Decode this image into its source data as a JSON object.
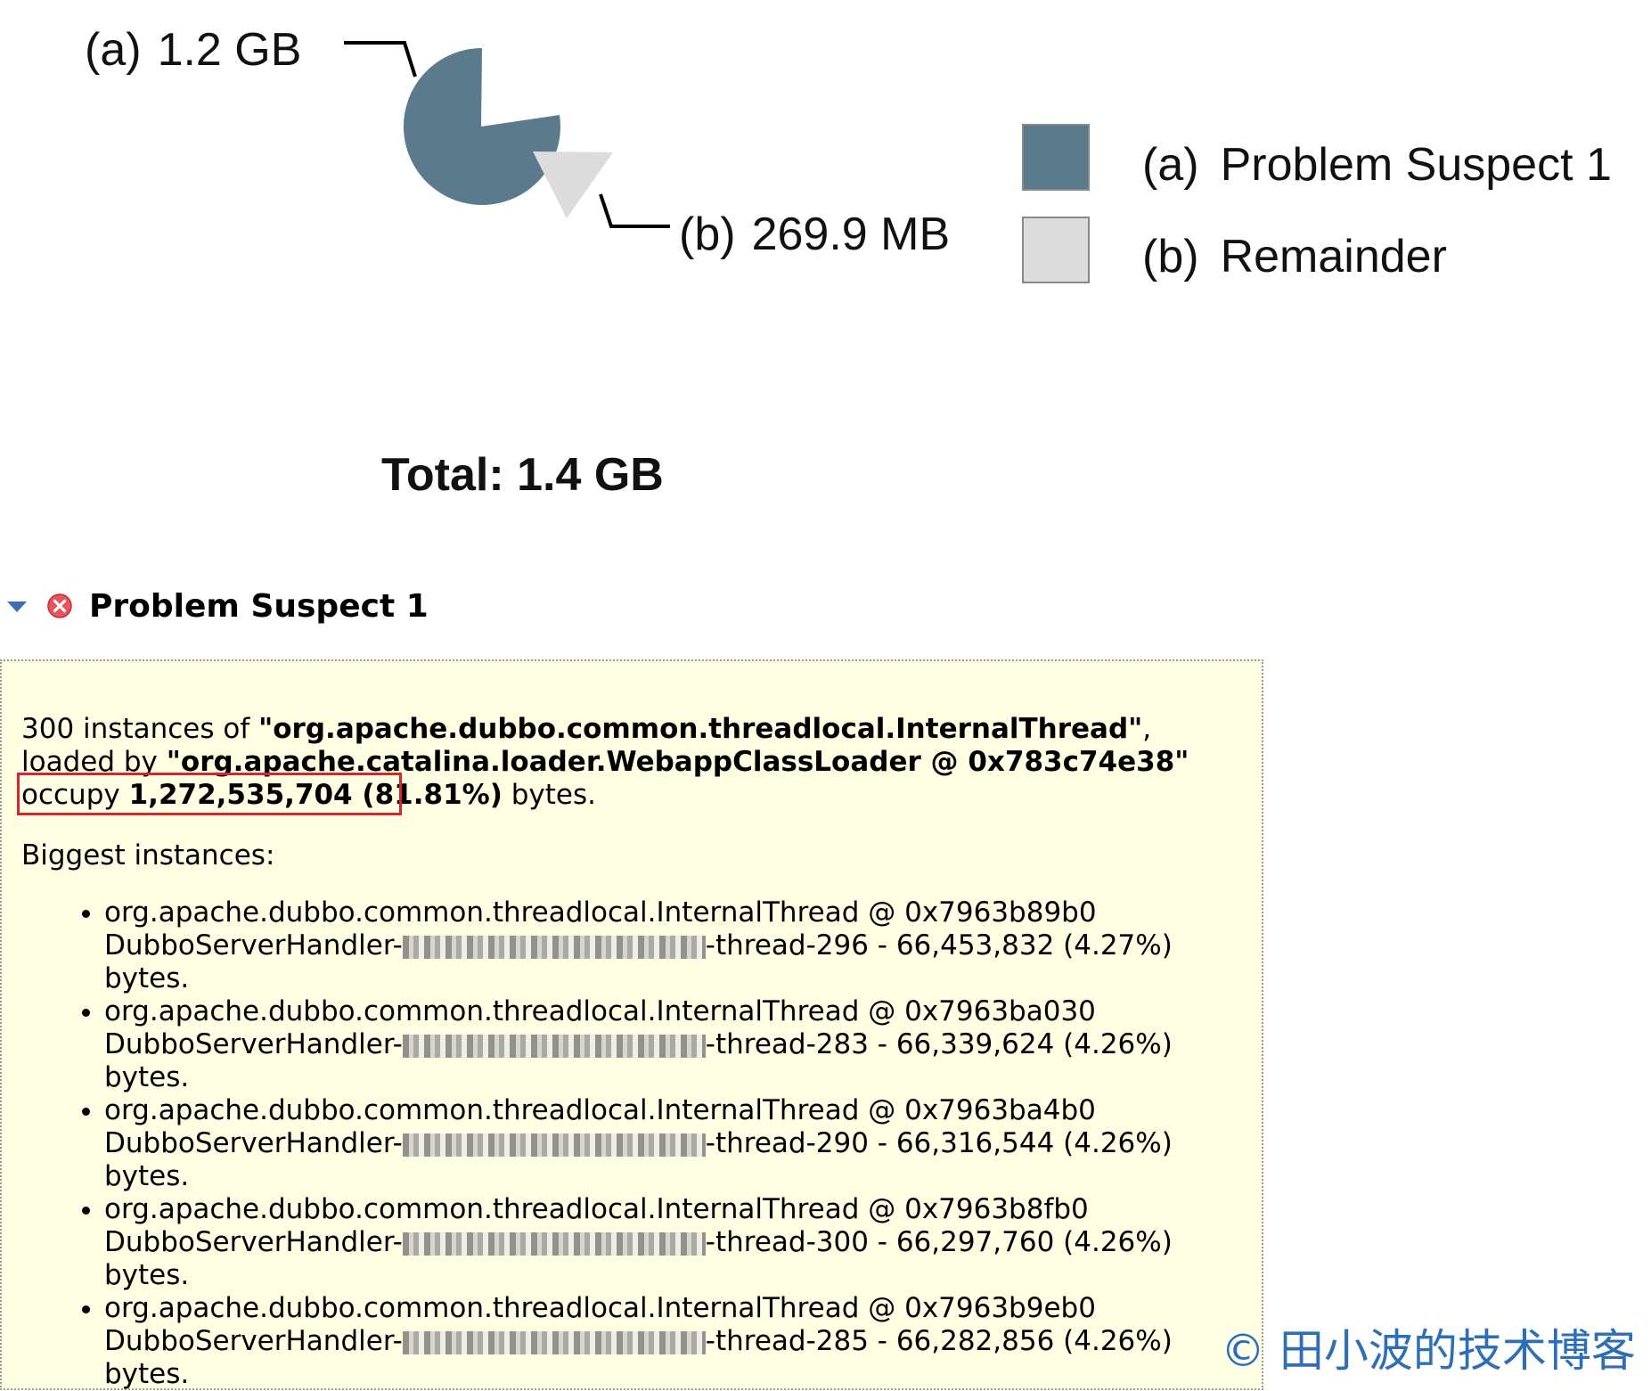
{
  "chart_data": {
    "type": "pie",
    "title": "",
    "slices": [
      {
        "label": "(a)",
        "value_text": "1.2 GB",
        "value_bytes": 1272535704,
        "legend": "Problem Suspect 1",
        "color": "#5b7a8c"
      },
      {
        "label": "(b)",
        "value_text": "269.9 MB",
        "value_bytes": 283007386,
        "legend": "Remainder",
        "color": "#dcdcdc"
      }
    ],
    "total_label": "Total: 1.4 GB",
    "legend_position": "right"
  },
  "section": {
    "title": "Problem Suspect 1",
    "expanded": true,
    "status_icon": "error-icon"
  },
  "suspect": {
    "count": "300",
    "instances_of": "instances of",
    "class_name": "\"org.apache.dubbo.common.threadlocal.InternalThread\"",
    "loaded_by_text": ", loaded by",
    "loader": "\"org.apache.catalina.loader.WebappClassLoader @ 0x783c74e38\"",
    "occupy_text": "occupy",
    "size": "1,272,535,704 (81.81%)",
    "bytes_text": "bytes.",
    "biggest_label": "Biggest instances:",
    "instances": [
      {
        "object": "org.apache.dubbo.common.threadlocal.InternalThread @ 0x7963b89b0",
        "handler": "DubboServerHandler-",
        "thread": "-thread-296 - 66,453,832 (4.27%)",
        "bytes": "bytes."
      },
      {
        "object": "org.apache.dubbo.common.threadlocal.InternalThread @ 0x7963ba030",
        "handler": "DubboServerHandler-",
        "thread": "-thread-283 - 66,339,624 (4.26%)",
        "bytes": "bytes."
      },
      {
        "object": "org.apache.dubbo.common.threadlocal.InternalThread @ 0x7963ba4b0",
        "handler": "DubboServerHandler-",
        "thread": "-thread-290 - 66,316,544 (4.26%)",
        "bytes": "bytes."
      },
      {
        "object": "org.apache.dubbo.common.threadlocal.InternalThread @ 0x7963b8fb0",
        "handler": "DubboServerHandler-",
        "thread": "-thread-300 - 66,297,760 (4.26%)",
        "bytes": "bytes."
      },
      {
        "object": "org.apache.dubbo.common.threadlocal.InternalThread @ 0x7963b9eb0",
        "handler": "DubboServerHandler-",
        "thread": "-thread-285 - 66,282,856 (4.26%)",
        "bytes": "bytes."
      }
    ]
  },
  "watermark": "© 田小波的技术博客"
}
